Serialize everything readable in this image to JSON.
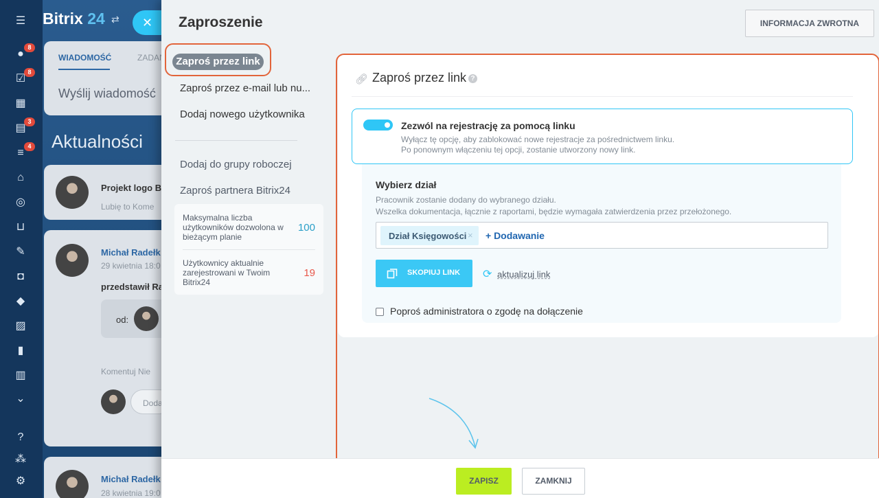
{
  "app": {
    "logo_main": "Bitrix",
    "logo_num": "24",
    "close_icon": "close-icon",
    "leftbar_badges": [
      "8",
      "8",
      "3",
      "4"
    ]
  },
  "background": {
    "tabs": [
      "WIADOMOŚĆ",
      "ZADAN"
    ],
    "send_message": "Wyślij wiadomość",
    "news_title": "Aktualności",
    "post1": {
      "title": "Projekt logo B",
      "meta": "Lubię to   Kome"
    },
    "post2": {
      "author": "Michał Radełk",
      "date": "29 kwietnia 18:0",
      "text": "przedstawił Rap",
      "od": "od:",
      "actions": "Komentuj   Nie",
      "reply_placeholder": "Doda"
    },
    "post3": {
      "author": "Michał Radełk",
      "date": "28 kwietnia 19:0"
    }
  },
  "slider": {
    "title": "Zaproszenie",
    "feedback_button": "INFORMACJA ZWROTNA",
    "nav": {
      "active": "Zaproś przez link",
      "items": [
        "Zaproś przez e-mail lub nu...",
        "Dodaj nowego użytkownika"
      ],
      "items2": [
        "Dodaj do grupy roboczej",
        "Zaproś partnera Bitrix24"
      ]
    },
    "stats": [
      {
        "label": "Maksymalna liczba użytkowników dozwolona w bieżącym planie",
        "value": "100",
        "color": "#2b9fc8"
      },
      {
        "label": "Użytkownicy aktualnie zarejestrowani w Twoim Bitrix24",
        "value": "19",
        "color": "#e8574a"
      }
    ],
    "content": {
      "title": "Zaproś przez link",
      "toggle_title": "Zezwól na rejestrację za pomocą linku",
      "toggle_desc1": "Wyłącz tę opcję, aby zablokować nowe rejestracje za pośrednictwem linku.",
      "toggle_desc2": "Po ponownym włączeniu tej opcji, zostanie utworzony nowy link.",
      "toggle_on": true,
      "dept_title": "Wybierz dział",
      "dept_desc1": "Pracownik zostanie dodany do wybranego działu.",
      "dept_desc2": "Wszelka dokumentacja, łącznie z raportami, będzie wymagała zatwierdzenia przez przełożonego.",
      "dept_tag": "Dział Księgowości",
      "add_label": "+ Dodawanie",
      "copy_button": "SKOPIUJ LINK",
      "refresh_link": "aktualizuj link",
      "approval_checkbox": "Poproś administratora o zgodę na dołączenie",
      "approval_checked": false
    },
    "footer": {
      "save": "ZAPISZ",
      "close": "ZAMKNIJ"
    }
  },
  "colors": {
    "accent": "#2fc6f6",
    "save": "#bbed21",
    "highlight": "#e2643a",
    "link": "#2066b0"
  }
}
